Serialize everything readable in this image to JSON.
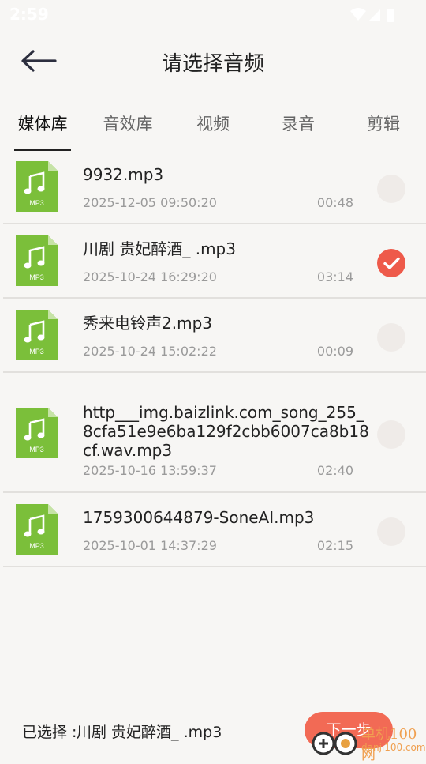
{
  "status_bar": {
    "time": "2:59",
    "icons": [
      "wifi-icon",
      "signal-icon",
      "battery-icon"
    ]
  },
  "header": {
    "title": "请选择音频",
    "back_icon": "back-arrow-icon"
  },
  "tabs": [
    {
      "label": "媒体库",
      "active": true
    },
    {
      "label": "音效库",
      "active": false
    },
    {
      "label": "视频",
      "active": false
    },
    {
      "label": "录音",
      "active": false
    },
    {
      "label": "剪辑",
      "active": false
    }
  ],
  "files": [
    {
      "name": "9932.mp3",
      "date": "2025-12-05 09:50:20",
      "duration": "00:48",
      "badge": "MP3",
      "selected": false
    },
    {
      "name": "川剧 贵妃醉酒_ .mp3",
      "date": "2025-10-24 16:29:20",
      "duration": "03:14",
      "badge": "MP3",
      "selected": true
    },
    {
      "name": "秀来电铃声2.mp3",
      "date": "2025-10-24 15:02:22",
      "duration": "00:09",
      "badge": "MP3",
      "selected": false
    },
    {
      "name": "http___img.baizlink.com_song_255_",
      "name2": "8cfa51e9e6ba129f2cbb6007ca8b18",
      "name3": "cf.wav.mp3",
      "date": "2025-10-16 13:59:37",
      "duration": "02:40",
      "badge": "MP3",
      "selected": false
    },
    {
      "name": "1759300644879-SoneAI.mp3",
      "date": "2025-10-01 14:37:29",
      "duration": "02:15",
      "badge": "MP3",
      "selected": false
    }
  ],
  "footer": {
    "selected_prefix": "已选择 :",
    "selected_name": "川剧 贵妃醉酒_ .mp3",
    "next_label": "下一步"
  },
  "watermark": {
    "brand": "单机100网",
    "url": "danji100.com"
  },
  "colors": {
    "accent": "#ee5a4a",
    "icon_green": "#7bbf3a",
    "background": "#f7f6f4"
  }
}
